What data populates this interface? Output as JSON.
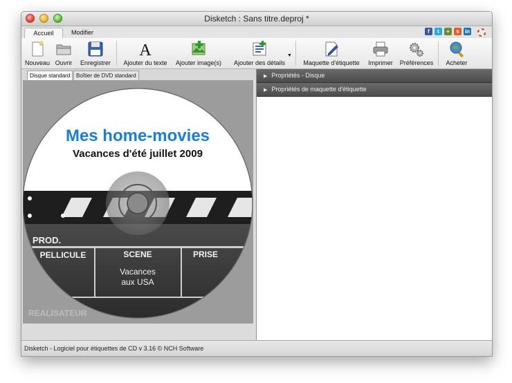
{
  "window": {
    "title": "Disketch : Sans titre.deproj *"
  },
  "ribbon_tabs": [
    {
      "label": "Accueil"
    },
    {
      "label": "Modifier"
    }
  ],
  "social_icons": [
    {
      "icon": "facebook-icon",
      "glyph": "f",
      "color": "#3b5998"
    },
    {
      "icon": "twitter-icon",
      "glyph": "t",
      "color": "#2aa9e0"
    },
    {
      "icon": "social-icon",
      "glyph": "+",
      "color": "#6a8a3a"
    },
    {
      "icon": "stumbleupon-icon",
      "glyph": "s",
      "color": "#e85a2a"
    },
    {
      "icon": "linkedin-icon",
      "glyph": "in",
      "color": "#1a76b0"
    },
    {
      "icon": "help-lifebuoy-icon",
      "glyph": "",
      "color": "#d84a3a"
    }
  ],
  "toolbar": {
    "new_label": "Nouveau",
    "open_label": "Ouvrir",
    "save_label": "Enregistrer",
    "add_text_label": "Ajouter du texte",
    "add_image_label": "Ajouter image(s)",
    "add_details_label": "Ajouter des détails",
    "label_layout_label": "Maquette d'étiquette",
    "print_label": "Imprimer",
    "preferences_label": "Préférences",
    "buy_label": "Acheter"
  },
  "sub_tabs": [
    {
      "label": "Disque standard"
    },
    {
      "label": "Boîtier de DVD standard"
    }
  ],
  "disc_label": {
    "title": "Mes home-movies",
    "subtitle": "Vacances d'été juillet 2009",
    "title_color": "#1a7fd4",
    "clapper": {
      "prod": "PROD.",
      "roll": "PELLICULE",
      "scene": "SCENE",
      "take": "PRISE",
      "scene_line1": "Vacances",
      "scene_line2": "aux USA",
      "director": "REALISATEUR"
    }
  },
  "properties_panels": [
    {
      "label": "Propriétés - Disque"
    },
    {
      "label": "Propriétés de maquette d'étiquette"
    }
  ],
  "status": {
    "text": "Disketch - Logiciel pour étiquettes de CD v 3.16 © NCH Software"
  }
}
